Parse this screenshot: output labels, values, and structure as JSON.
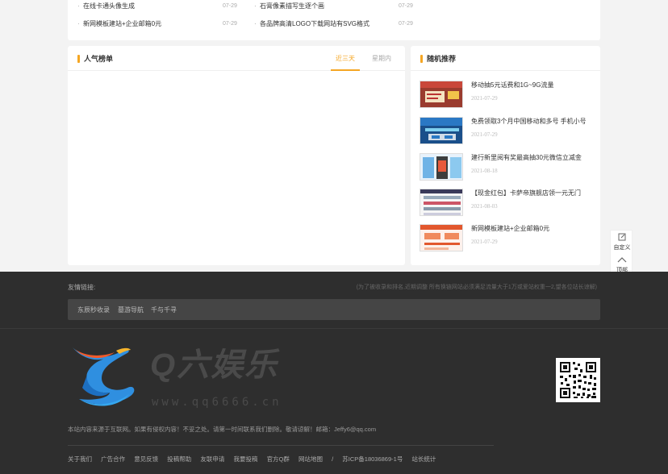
{
  "top_news": [
    {
      "title": "在线卡通头像生成",
      "date": "07-29"
    },
    {
      "title": "石膏像素描写生逐个画",
      "date": "07-29"
    },
    {
      "title": "新网模板建站+企业邮箱0元",
      "date": "07-29"
    },
    {
      "title": "各品牌高清LOGO下载网站有SVG格式",
      "date": "07-29"
    }
  ],
  "popular": {
    "title": "人气榜单",
    "tabs": [
      "近三天",
      "星期内"
    ],
    "active_tab": "近三天"
  },
  "random": {
    "title": "随机推荐",
    "items": [
      {
        "title": "移动抽5元话费和1G~9G流量",
        "date": "2021-07-29"
      },
      {
        "title": "免费领取3个月中国移动和多号 手机小号",
        "date": "2021-07-29"
      },
      {
        "title": "建行新里阅有奖最高抽30元微信立减金",
        "date": "2021-08-18"
      },
      {
        "title": "【现金红包】卡萨帝旗舰店领一元无门",
        "date": "2021-08-03"
      },
      {
        "title": "新网模板建站+企业邮箱0元",
        "date": "2021-07-29"
      }
    ]
  },
  "float_tools": {
    "custom_label": "自定义",
    "top_label": "顶部"
  },
  "footer": {
    "links_label": "友情链接:",
    "links_note": "(为了被收录和排名,近期调整 所有换链网站必须满足流量大于1万或爱站权重一2,望各位站长谅解)",
    "links": [
      "东辰秒收录",
      "墓游导航",
      "千与千寻"
    ],
    "logo_text": "Q六娱乐",
    "logo_url": "www.qq6666.cn",
    "copyright": "本站内容来源于互联网。如果有侵权内容！不妥之处。请第一时间联系我们删除。敬请谅解！邮箱：Jeffy6@qq.com",
    "nav": [
      "关于我们",
      "广告合作",
      "意见反馈",
      "投稿帮助",
      "友联申请",
      "我要投稿",
      "官方Q群",
      "网站地图",
      "/",
      "苏ICP备18036869-1号",
      "站长统计"
    ]
  },
  "colors": {
    "accent": "#f5a623",
    "footer_bg": "#2e2e2e",
    "page_bg": "#f3f3f3"
  }
}
